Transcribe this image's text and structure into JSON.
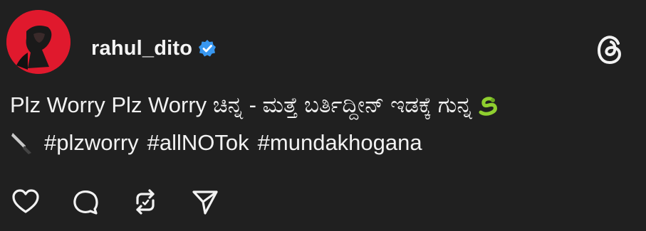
{
  "post": {
    "username": "rahul_dito",
    "verified_icon": "verified-badge-icon",
    "platform_icon": "threads-logo-icon",
    "text_line1": "Plz Worry Plz Worry ಚಿನ್ನ - ಮತ್ತೆ ಬರ್ತಿದ್ದೀನ್ ಇಡಕ್ಕೆ ಗುನ್ನ",
    "emoji_snake": "🐍",
    "emoji_knife": "🔪",
    "hashtags": [
      "#plzworry",
      "#allNOTok",
      "#mundakhogana"
    ]
  },
  "actions": {
    "like_icon": "heart-icon",
    "comment_icon": "comment-icon",
    "repost_icon": "repost-icon",
    "share_icon": "send-icon"
  },
  "colors": {
    "background": "#202020",
    "text": "#f2f2f2",
    "verified": "#3897f0",
    "avatar_bg": "#e0192d"
  }
}
